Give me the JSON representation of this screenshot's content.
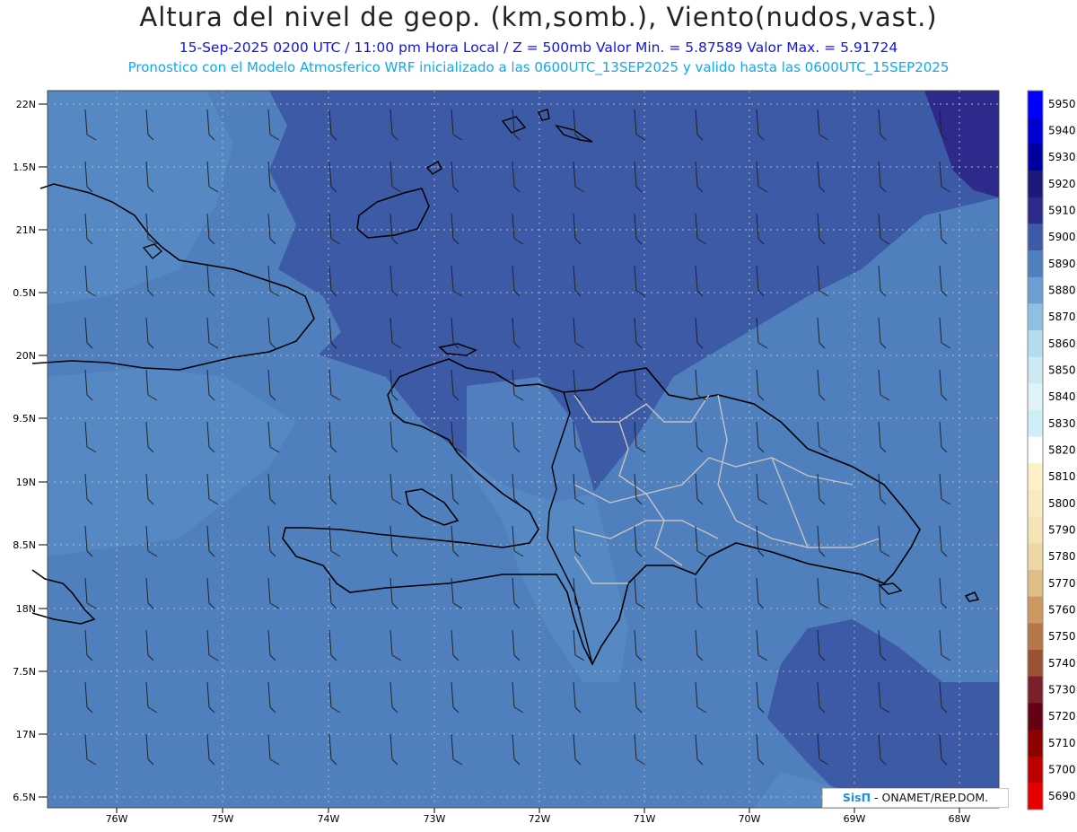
{
  "header": {
    "title": "Altura del nivel de geop. (km,somb.), Viento(nudos,vast.)",
    "subtitle": "15-Sep-2025  0200 UTC  /  11:00 pm Hora Local  /  Z = 500mb     Valor Min. = 5.87589   Valor Max. = 5.91724",
    "info": "Pronostico con el Modelo Atmosferico WRF inicializado a las 0600UTC_13SEP2025 y valido hasta las  0600UTC_15SEP2025"
  },
  "map": {
    "lat_labels": [
      "22N",
      "1.5N",
      "21N",
      "0.5N",
      "20N",
      "9.5N",
      "19N",
      "8.5N",
      "18N",
      "7.5N",
      "17N",
      "6.5N"
    ],
    "lon_labels": [
      "76W",
      "75W",
      "74W",
      "73W",
      "72W",
      "71W",
      "70W",
      "69W",
      "68W"
    ],
    "colors": {
      "base": "#4f7fbd",
      "band_5900": "#3d5aa7",
      "band_5910": "#2c2b8c",
      "band_5890": "#5a8dc8",
      "coast": "#000000",
      "provinces": "#c4c4c4"
    }
  },
  "colorbar": {
    "entries": [
      {
        "label": "5950",
        "color": "#0000ff"
      },
      {
        "label": "5940",
        "color": "#0000d2"
      },
      {
        "label": "5930",
        "color": "#00009c"
      },
      {
        "label": "5920",
        "color": "#1a1a78"
      },
      {
        "label": "5910",
        "color": "#2b2b8c"
      },
      {
        "label": "5900",
        "color": "#3d5aa7"
      },
      {
        "label": "5890",
        "color": "#4f7fbd"
      },
      {
        "label": "5880",
        "color": "#6d9ed2"
      },
      {
        "label": "5870",
        "color": "#90c0e1"
      },
      {
        "label": "5860",
        "color": "#b3dcec"
      },
      {
        "label": "5850",
        "color": "#cdeaf3"
      },
      {
        "label": "5840",
        "color": "#dff2f7"
      },
      {
        "label": "5830",
        "color": "#cdf0f7"
      },
      {
        "label": "5820",
        "color": "#ffffff"
      },
      {
        "label": "5810",
        "color": "#fbf1c4"
      },
      {
        "label": "5800",
        "color": "#f7ebc0"
      },
      {
        "label": "5790",
        "color": "#f3e3b6"
      },
      {
        "label": "5780",
        "color": "#ecd7a4"
      },
      {
        "label": "5770",
        "color": "#dfbd86"
      },
      {
        "label": "5760",
        "color": "#cc9963"
      },
      {
        "label": "5750",
        "color": "#b47848"
      },
      {
        "label": "5740",
        "color": "#9b5233"
      },
      {
        "label": "5730",
        "color": "#7b1f2d"
      },
      {
        "label": "5720",
        "color": "#660014"
      },
      {
        "label": "5710",
        "color": "#8b0000"
      },
      {
        "label": "5700",
        "color": "#bc0000"
      },
      {
        "label": "5690",
        "color": "#e60000"
      }
    ]
  },
  "credit": {
    "logo": "SisΠ",
    "text": " - ONAMET/REP.DOM."
  }
}
